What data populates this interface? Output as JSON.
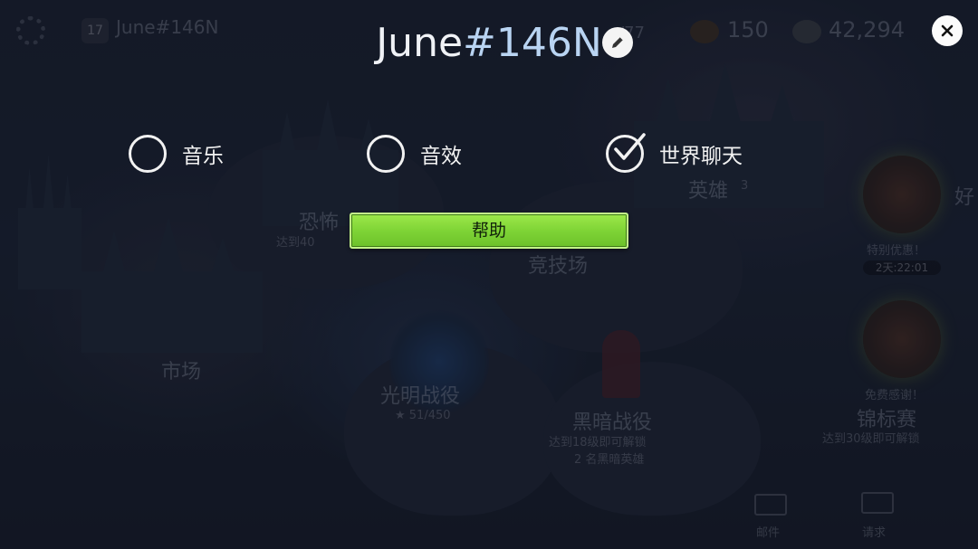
{
  "dialog": {
    "player_name_base": "June",
    "player_name_tag": "#146N",
    "help_label": "帮助",
    "options": [
      {
        "label": "音乐",
        "checked": false
      },
      {
        "label": "音效",
        "checked": false
      },
      {
        "label": "世界聊天",
        "checked": true
      }
    ]
  },
  "background": {
    "player_level": "17",
    "player_name": "June#146N",
    "energy": "/77",
    "gold": "150",
    "silver": "42,294",
    "locations": {
      "heroes": "英雄",
      "heroes_badge": "3",
      "fear": "恐怖",
      "fear_lock": "达到40",
      "arena": "竞技场",
      "market": "市场",
      "light_campaign": "光明战役",
      "light_stars": "★ 51/450",
      "dark_campaign": "黑暗战役",
      "dark_lock": "达到18级即可解锁",
      "dark_heroes": "2 名黑暗英雄",
      "championship": "锦标赛",
      "championship_lock": "达到30级即可解锁"
    },
    "offers": {
      "special_offer": "特别优惠！",
      "special_timer": "2天:22:01",
      "free_quest": "免费感谢！",
      "friends": "好"
    },
    "bottom": {
      "mail": "邮件",
      "quests": "请求"
    }
  },
  "colors": {
    "accent_green": "#7fd436",
    "name_tag_blue": "#b9d4f2",
    "overlay": "#151b29"
  }
}
